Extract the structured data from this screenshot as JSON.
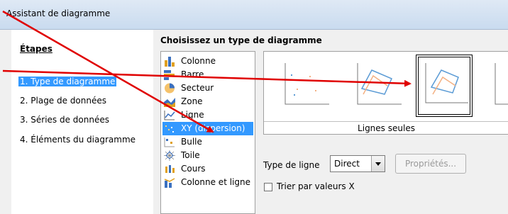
{
  "window": {
    "title": "Assistant de diagramme"
  },
  "steps": {
    "heading": "Étapes",
    "items": [
      {
        "label": "1. Type de diagramme",
        "selected": true
      },
      {
        "label": "2. Plage de données",
        "selected": false
      },
      {
        "label": "3. Séries de données",
        "selected": false
      },
      {
        "label": "4. Éléments du diagramme",
        "selected": false
      }
    ]
  },
  "chart_type": {
    "heading": "Choisissez un type de diagramme",
    "types": [
      {
        "label": "Colonne",
        "icon": "column-chart-icon",
        "selected": false
      },
      {
        "label": "Barre",
        "icon": "bar-chart-icon",
        "selected": false
      },
      {
        "label": "Secteur",
        "icon": "pie-chart-icon",
        "selected": false
      },
      {
        "label": "Zone",
        "icon": "area-chart-icon",
        "selected": false
      },
      {
        "label": "Ligne",
        "icon": "line-chart-icon",
        "selected": false
      },
      {
        "label": "XY (dispersion)",
        "icon": "xy-scatter-chart-icon",
        "selected": true
      },
      {
        "label": "Bulle",
        "icon": "bubble-chart-icon",
        "selected": false
      },
      {
        "label": "Toile",
        "icon": "net-chart-icon",
        "selected": false
      },
      {
        "label": "Cours",
        "icon": "stock-chart-icon",
        "selected": false
      },
      {
        "label": "Colonne et ligne",
        "icon": "column-line-chart-icon",
        "selected": false
      }
    ],
    "variant_label": "Lignes seules",
    "line_type_label": "Type de ligne",
    "line_type_value": "Direct",
    "properties_button": "Propriétés...",
    "sort_checkbox_label": "Trier par valeurs X",
    "sort_checked": false
  },
  "colors": {
    "selection": "#3399ff",
    "arrow": "#e00000",
    "series_blue": "#5b9bd5",
    "series_orange": "#f4b183"
  }
}
